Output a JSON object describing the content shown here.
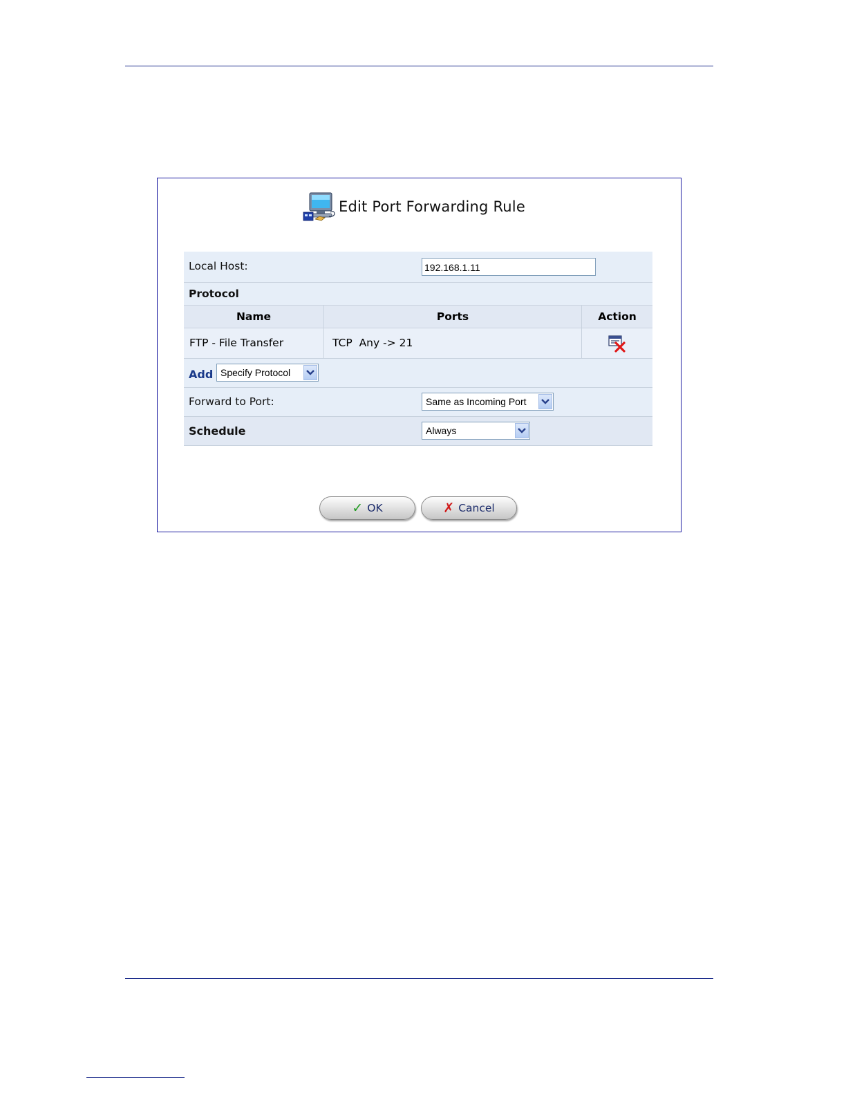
{
  "dialog": {
    "title": "Edit Port Forwarding Rule"
  },
  "local_host": {
    "label": "Local Host:",
    "value": "192.168.1.11"
  },
  "protocol": {
    "section_label": "Protocol",
    "columns": [
      "Name",
      "Ports",
      "Action"
    ],
    "rows": [
      {
        "name": "FTP - File Transfer",
        "ports": "TCP  Any -> 21"
      }
    ],
    "add_label": "Add",
    "add_select_value": "Specify Protocol"
  },
  "forward_to_port": {
    "label": "Forward to Port:",
    "value": "Same as Incoming Port"
  },
  "schedule": {
    "label": "Schedule",
    "value": "Always"
  },
  "buttons": {
    "ok_label": "OK",
    "cancel_label": "Cancel"
  },
  "colors": {
    "row_bg": "#e6eef8",
    "border_blue": "#1a1aa0",
    "add_label_color": "#1a3a8a"
  }
}
